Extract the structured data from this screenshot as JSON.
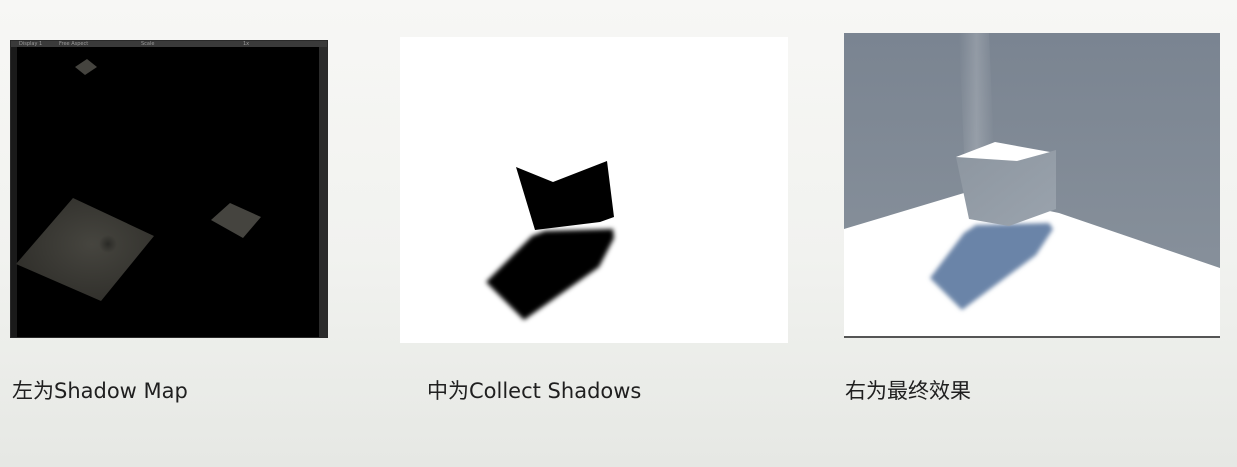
{
  "panels": {
    "left": {
      "toolbar": {
        "display": "Display 1",
        "aspect": "Free Aspect",
        "scale": "Scale",
        "value": "1x"
      }
    }
  },
  "captions": {
    "left": "左为Shadow Map",
    "middle": "中为Collect Shadows",
    "right": "右为最终效果"
  },
  "colors": {
    "background": "#f3f4f1",
    "shadow_map_bg": "#000000",
    "shadow_map_plane": "#3d3c38",
    "scene_wall": "#7d8793",
    "scene_floor": "#ffffff",
    "scene_shadow": "#6b84a8"
  }
}
